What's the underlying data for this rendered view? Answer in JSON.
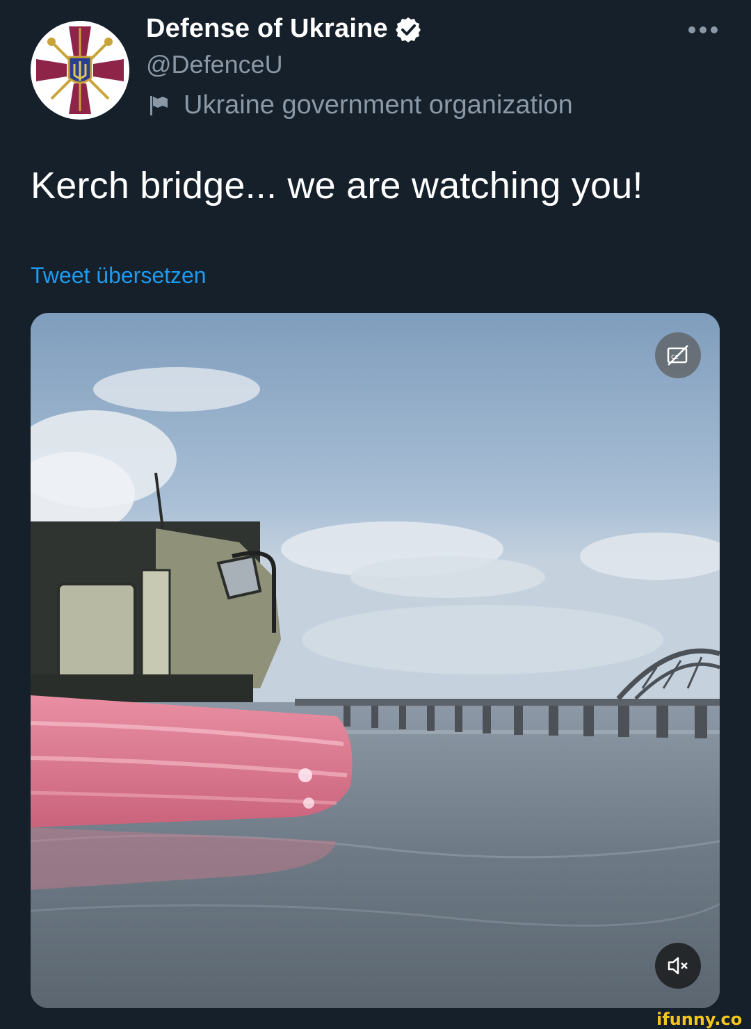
{
  "tweet": {
    "display_name": "Defense of Ukraine",
    "verified_icon": "verified-badge-icon",
    "handle": "@DefenceU",
    "org_label": "Ukraine government organization",
    "org_icon": "flag-icon",
    "more_icon": "more-dots-icon",
    "text": "Kerch bridge... we are watching you!",
    "translate_label": "Tweet übersetzen",
    "avatar_icon": "ministry-emblem-icon"
  },
  "media": {
    "type": "video",
    "cc_icon": "captions-off-icon",
    "mute_icon": "muted-speaker-icon"
  },
  "watermark": {
    "text": "ifunny.co"
  },
  "colors": {
    "background": "#15202b",
    "secondary_text": "#8b98a5",
    "link": "#1d9bf0",
    "watermark": "#f4c51d"
  }
}
